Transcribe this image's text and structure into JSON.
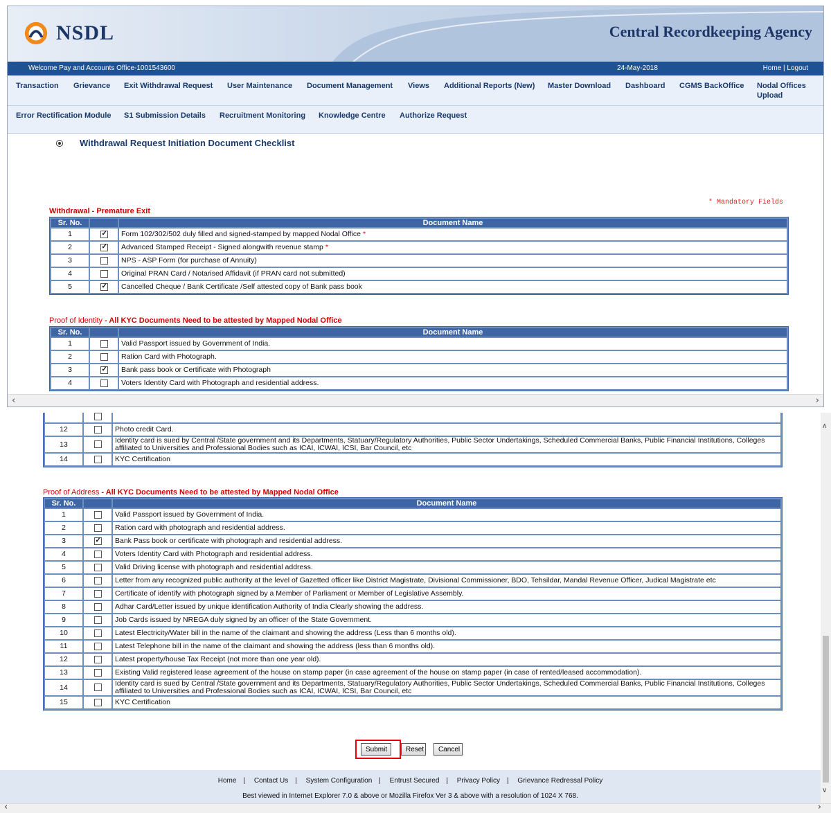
{
  "header": {
    "logo_text": "NSDL",
    "agency_title": "Central Recordkeeping Agency",
    "welcome": "Welcome Pay and Accounts Office-1001543600",
    "date": "24-May-2018",
    "home_logout": "Home | Logout"
  },
  "menu": {
    "row1": [
      "Transaction",
      "Grievance",
      "Exit Withdrawal Request",
      "User Maintenance",
      "Document Management",
      "Views",
      "Additional Reports (New)",
      "Master Download",
      "Dashboard",
      "CGMS BackOffice",
      "Nodal Offices",
      "Upload"
    ],
    "row2": [
      "Error Rectification Module",
      "S1 Submission Details",
      "Recruitment Monitoring",
      "Knowledge Centre",
      "Authorize Request"
    ]
  },
  "page": {
    "title": "Withdrawal Request Initiation Document Checklist",
    "mandatory_note": "* Mandatory Fields"
  },
  "columns": {
    "sr": "Sr. No.",
    "doc": "Document Name"
  },
  "sections": {
    "premature": {
      "heading": "Withdrawal - Premature Exit",
      "rows": [
        {
          "no": "1",
          "checked": true,
          "name": "Form 102/302/502 duly filled and signed-stamped by mapped Nodal Office",
          "required": "*"
        },
        {
          "no": "2",
          "checked": true,
          "name": "Advanced Stamped Receipt - Signed alongwith revenue stamp",
          "required": "*"
        },
        {
          "no": "3",
          "checked": false,
          "name": "NPS - ASP Form (for purchase of Annuity)",
          "required": ""
        },
        {
          "no": "4",
          "checked": false,
          "name": "Original PRAN Card / Notarised Affidavit (if PRAN card not submitted)",
          "required": ""
        },
        {
          "no": "5",
          "checked": true,
          "name": "Cancelled Cheque / Bank Certificate /Self attested copy of Bank pass book",
          "required": ""
        }
      ]
    },
    "identity": {
      "heading_prefix": "Proof of Identity",
      "heading_suffix": " - All KYC Documents Need to be attested by Mapped Nodal Office",
      "rows_top": [
        {
          "no": "1",
          "checked": false,
          "name": "Valid Passport issued by Government of India."
        },
        {
          "no": "2",
          "checked": false,
          "name": "Ration Card with Photograph."
        },
        {
          "no": "3",
          "checked": true,
          "name": "Bank pass book or Certificate with Photograph"
        },
        {
          "no": "4",
          "checked": false,
          "name": "Voters Identity Card with Photograph and residential address."
        }
      ],
      "rows_bottom": [
        {
          "no": "12",
          "checked": false,
          "name": "Photo credit Card."
        },
        {
          "no": "13",
          "checked": false,
          "name": "Identity card is sued by Central /State government and its Departments, Statuary/Regulatory Authorities, Public Sector Undertakings, Scheduled Commercial Banks, Public Financial Institutions, Colleges affiliated to Universities and Professional Bodies such as ICAI, ICWAI, ICSI, Bar Council, etc"
        },
        {
          "no": "14",
          "checked": false,
          "name": "KYC Certification"
        }
      ]
    },
    "address": {
      "heading_prefix": "Proof of Address",
      "heading_suffix": " - All KYC Documents Need to be attested by Mapped Nodal Office",
      "rows": [
        {
          "no": "1",
          "checked": false,
          "name": "Valid Passport issued by Government of India."
        },
        {
          "no": "2",
          "checked": false,
          "name": "Ration card with photograph and residential address."
        },
        {
          "no": "3",
          "checked": true,
          "name": "Bank Pass book or certificate with photograph and residential address."
        },
        {
          "no": "4",
          "checked": false,
          "name": "Voters Identity Card with Photograph and residential address."
        },
        {
          "no": "5",
          "checked": false,
          "name": "Valid Driving license with photograph and residential address."
        },
        {
          "no": "6",
          "checked": false,
          "name": "Letter from any recognized public authority at the level of Gazetted officer like District Magistrate, Divisional Commissioner, BDO, Tehsildar, Mandal Revenue Officer, Judical Magistrate etc"
        },
        {
          "no": "7",
          "checked": false,
          "name": "Certificate of identify with photograph signed by a Member of Parliament or Member of Legislative Assembly."
        },
        {
          "no": "8",
          "checked": false,
          "name": "Adhar Card/Letter issued by unique identification Authority of India Clearly showing the address."
        },
        {
          "no": "9",
          "checked": false,
          "name": "Job Cards issued by NREGA duly signed by an officer of the State Government."
        },
        {
          "no": "10",
          "checked": false,
          "name": "Latest Electricity/Water bill in the name of the claimant and showing the address (Less than 6 months old)."
        },
        {
          "no": "11",
          "checked": false,
          "name": "Latest Telephone bill in the name of the claimant and showing the address (less than 6 months old)."
        },
        {
          "no": "12",
          "checked": false,
          "name": "Latest property/house Tax Receipt (not more than one year old)."
        },
        {
          "no": "13",
          "checked": false,
          "name": "Existing Valid registered lease agreement of the house on stamp paper (in case agreement of the house on stamp paper (in case of rented/leased accommodation)."
        },
        {
          "no": "14",
          "checked": false,
          "name": "Identity card is sued by Central /State government and its Departments, Statuary/Regulatory Authorities, Public Sector Undertakings, Scheduled Commercial Banks, Public Financial Institutions, Colleges affiliated to Universities and Professional Bodies such as ICAI, ICWAI, ICSI, Bar Council, etc"
        },
        {
          "no": "15",
          "checked": false,
          "name": "KYC Certification"
        }
      ]
    }
  },
  "buttons": {
    "submit": "Submit",
    "reset": "Reset",
    "cancel": "Cancel"
  },
  "footer": {
    "links": [
      "Home",
      "Contact Us",
      "System Configuration",
      "Entrust Secured",
      "Privacy Policy",
      "Grievance Redressal Policy"
    ],
    "note": "Best viewed in Internet Explorer 7.0 & above or Mozilla Firefox Ver 3 & above with a resolution of 1024 X 768."
  },
  "colors": {
    "accent": "#1e5293",
    "header_cell": "#3e66a5",
    "section_red": "#d40000",
    "highlight": "#ff0000"
  },
  "icons": [
    "nsdl-logo-icon",
    "bullet-icon",
    "checkbox-icon",
    "scroll-left-icon",
    "scroll-right-icon",
    "scroll-up-icon",
    "scroll-down-icon"
  ]
}
